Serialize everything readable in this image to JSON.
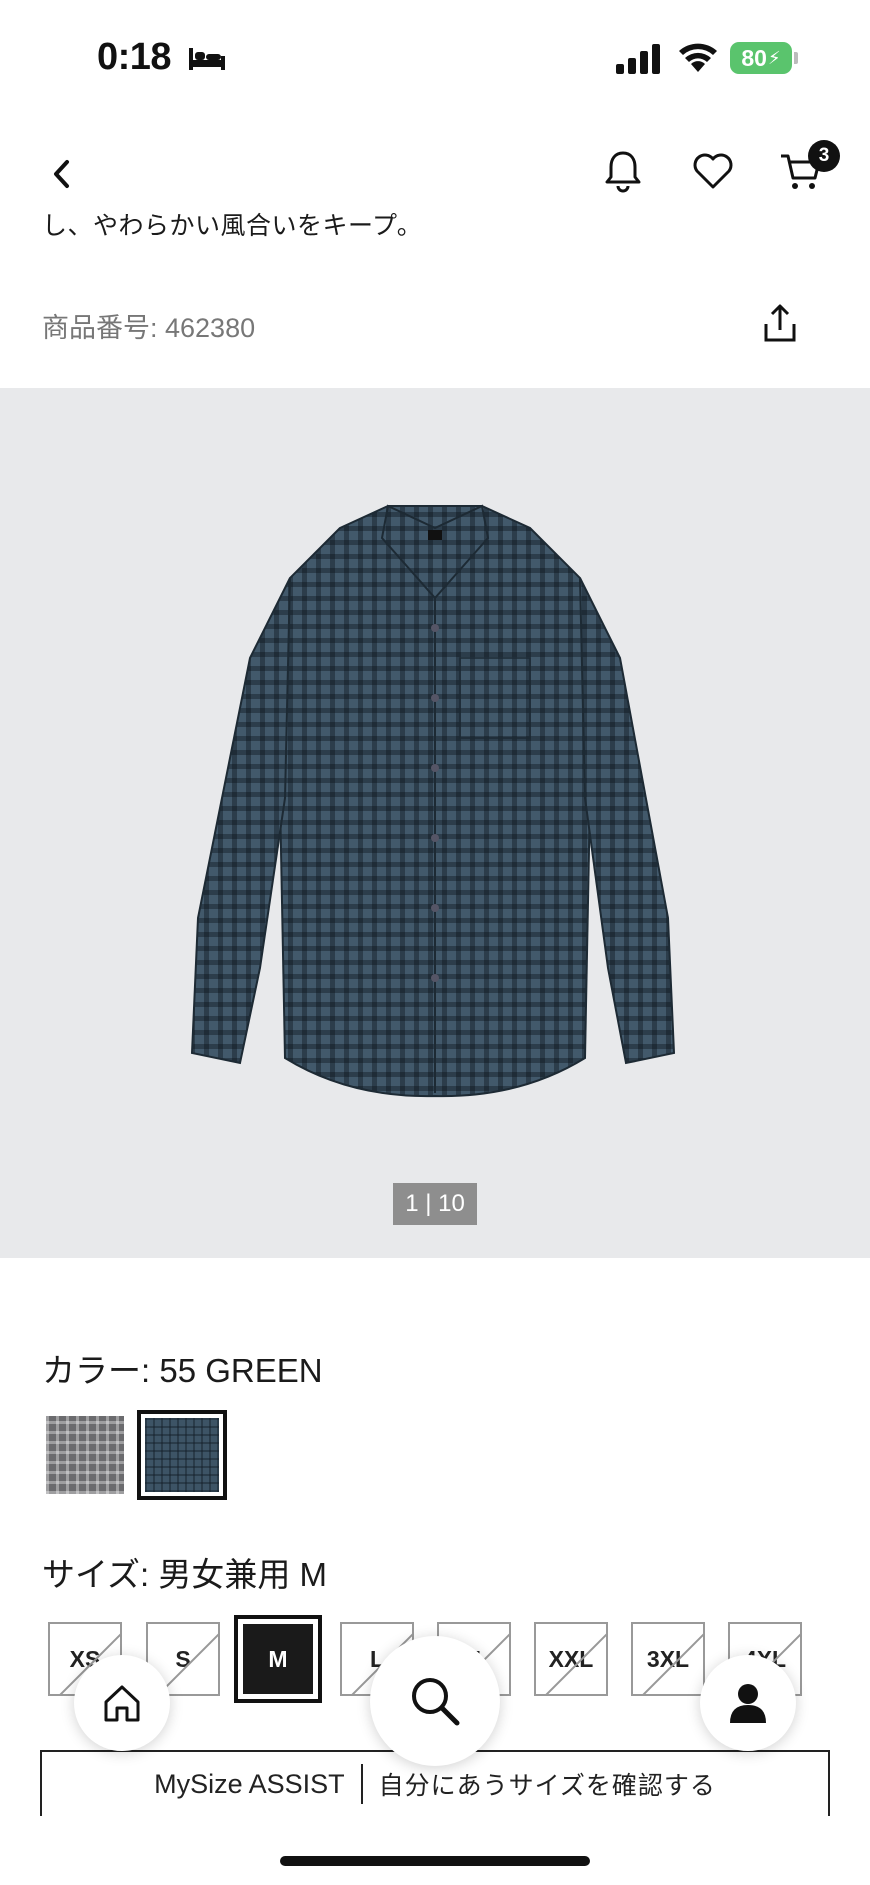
{
  "status_bar": {
    "time": "0:18",
    "battery": "80",
    "battery_color": "#5ac46d",
    "icons": [
      "bed-icon",
      "cellular-signal-icon",
      "wifi-icon",
      "battery-charging-icon"
    ]
  },
  "header": {
    "icons": [
      "back-chevron-icon",
      "bell-icon",
      "heart-icon",
      "cart-icon"
    ],
    "cart_count": "3"
  },
  "product": {
    "description_tail": "し、やわらかい風合いをキープ。",
    "number": "商品番号: 462380",
    "image_alt": "green gingham check button-down shirt",
    "image_indicator": "1 | 10"
  },
  "color": {
    "label": "カラー: 55 GREEN",
    "swatches": [
      {
        "name": "gray-check",
        "color": "#6b6b6e",
        "selected": false
      },
      {
        "name": "green-check",
        "color": "#3d5466",
        "selected": true
      }
    ]
  },
  "size": {
    "label": "サイズ: 男女兼用 M",
    "options": [
      "XS",
      "S",
      "M",
      "L",
      "XL",
      "XXL",
      "3XL",
      "4XL"
    ],
    "selected": "M"
  },
  "bottom_nav": {
    "icons": [
      "home-icon",
      "search-icon",
      "account-icon"
    ]
  },
  "mysize": {
    "brand": "MySize ASSIST",
    "action": "自分にあうサイズを確認する"
  }
}
